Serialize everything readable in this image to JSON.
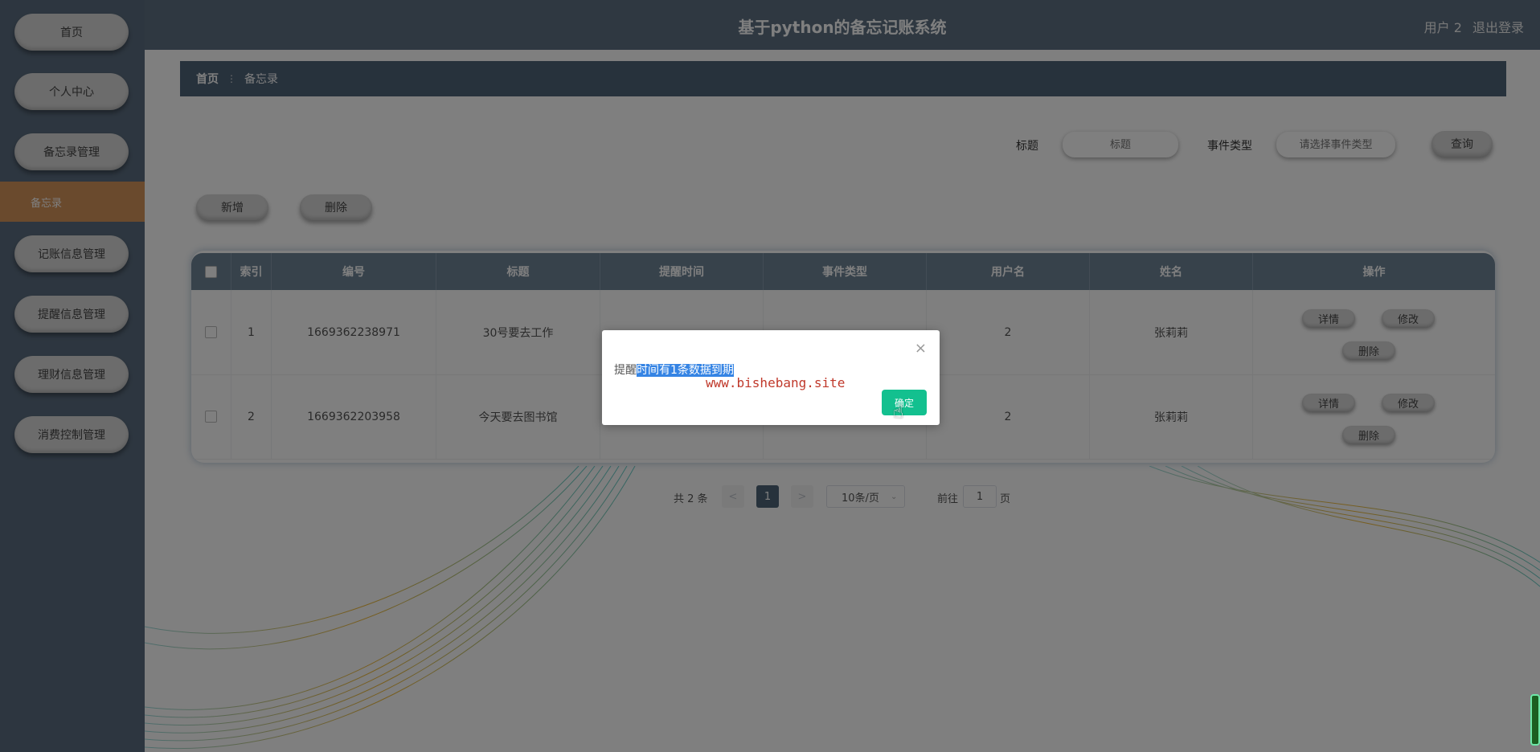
{
  "app": {
    "title": "基于python的备忘记账系统",
    "user": "用户 2",
    "logout": "退出登录"
  },
  "sidebar": {
    "items": [
      "首页",
      "个人中心",
      "备忘录管理",
      "备忘录",
      "记账信息管理",
      "提醒信息管理",
      "理财信息管理",
      "消费控制管理"
    ]
  },
  "breadcrumb": {
    "home": "首页",
    "current": "备忘录"
  },
  "search": {
    "title_label": "标题",
    "title_placeholder": "标题",
    "type_label": "事件类型",
    "type_placeholder": "请选择事件类型",
    "query_btn": "查询"
  },
  "actions": {
    "add": "新增",
    "delete": "删除"
  },
  "table": {
    "columns": [
      "索引",
      "编号",
      "标题",
      "提醒时间",
      "事件类型",
      "用户名",
      "姓名",
      "操作"
    ],
    "rows": [
      {
        "index": "1",
        "code": "1669362238971",
        "title": "30号要去工作",
        "user": "2",
        "name": "张莉莉"
      },
      {
        "index": "2",
        "code": "1669362203958",
        "title": "今天要去图书馆",
        "user": "2",
        "name": "张莉莉"
      }
    ],
    "ops": {
      "detail": "详情",
      "edit": "修改",
      "delete": "删除"
    }
  },
  "pagination": {
    "total": "共 2 条",
    "prev": "<",
    "page": "1",
    "next": ">",
    "size": "10条/页",
    "goto": "前往",
    "goto_value": "1",
    "page_unit": "页"
  },
  "modal": {
    "msg_prefix": "提醒",
    "msg_highlight": "时间有1条数据到期",
    "watermark": "www.bishebang.site",
    "ok": "确定",
    "close": "×"
  }
}
